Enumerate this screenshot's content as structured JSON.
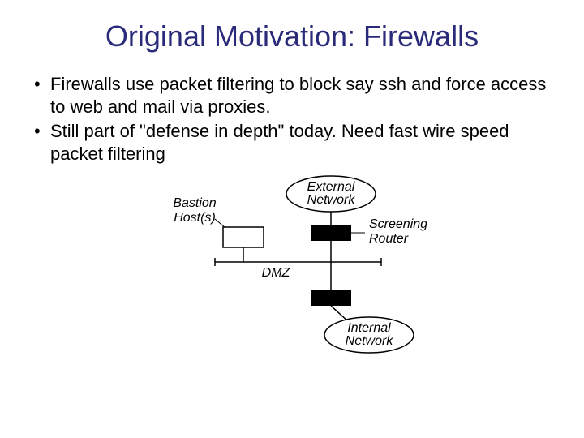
{
  "title": "Original Motivation: Firewalls",
  "bullets": [
    "Firewalls use packet filtering to block say ssh and force access to web and mail via proxies.",
    "Still part of \"defense in depth\" today.  Need fast wire speed packet filtering"
  ],
  "diagram": {
    "bastion_l1": "Bastion",
    "bastion_l2": "Host(s)",
    "external_l1": "External",
    "external_l2": "Network",
    "screening_l1": "Screening",
    "screening_l2": "Router",
    "dmz": "DMZ",
    "internal_l1": "Internal",
    "internal_l2": "Network"
  }
}
